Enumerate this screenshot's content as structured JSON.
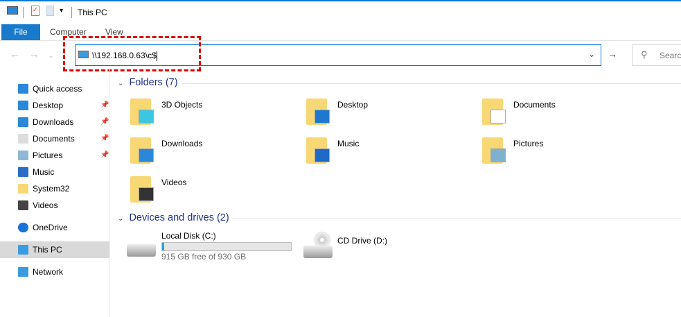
{
  "window": {
    "title": "This PC"
  },
  "ribbon": {
    "file": "File",
    "tabs": [
      "Computer",
      "View"
    ]
  },
  "address": {
    "value": "\\\\192.168.0.63\\c$"
  },
  "search": {
    "placeholder": "Search"
  },
  "sidebar": {
    "items": [
      {
        "label": "Quick access",
        "icon": "star-icon"
      },
      {
        "label": "Desktop",
        "icon": "desktop-icon",
        "pinned": true
      },
      {
        "label": "Downloads",
        "icon": "download-icon",
        "pinned": true
      },
      {
        "label": "Documents",
        "icon": "document-icon",
        "pinned": true
      },
      {
        "label": "Pictures",
        "icon": "pictures-icon",
        "pinned": true
      },
      {
        "label": "Music",
        "icon": "music-icon"
      },
      {
        "label": "System32",
        "icon": "folder-icon"
      },
      {
        "label": "Videos",
        "icon": "video-icon"
      },
      {
        "label": "OneDrive",
        "icon": "cloud-icon"
      },
      {
        "label": "This PC",
        "icon": "computer-icon",
        "selected": true
      },
      {
        "label": "Network",
        "icon": "network-icon"
      }
    ]
  },
  "folders": {
    "header": "Folders (7)",
    "items": [
      "3D Objects",
      "Desktop",
      "Documents",
      "Downloads",
      "Music",
      "Pictures",
      "Videos"
    ]
  },
  "drives": {
    "header": "Devices and drives (2)",
    "items": [
      {
        "label": "Local Disk (C:)",
        "free": "915 GB free of 930 GB",
        "used_percent": 1.6
      },
      {
        "label": "CD Drive (D:)"
      }
    ]
  },
  "colors": {
    "accent": "#0078d7",
    "highlight": "#e00000"
  }
}
